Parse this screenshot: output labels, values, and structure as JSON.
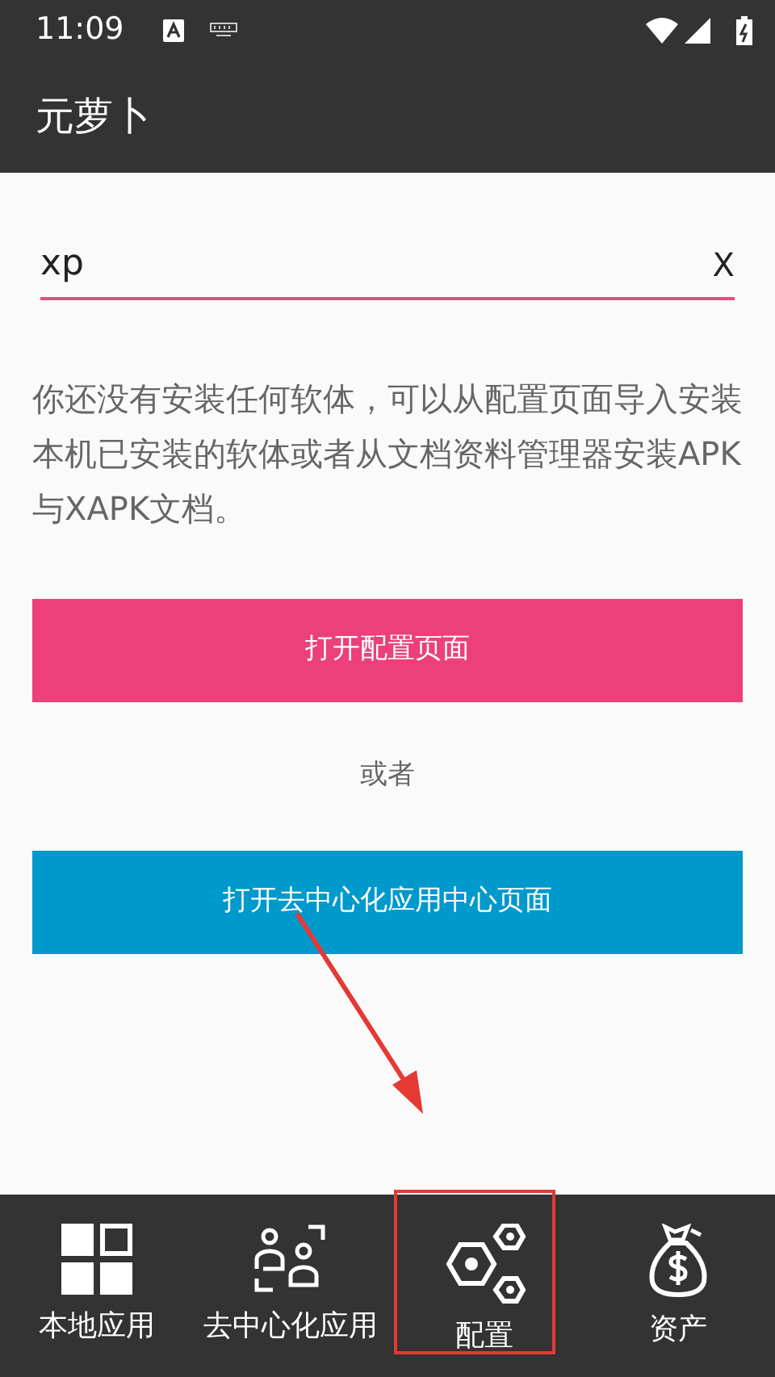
{
  "status_bar": {
    "time": "11:09"
  },
  "app_bar": {
    "title": "元萝卜"
  },
  "search": {
    "value": "xp",
    "clear": "X"
  },
  "message": "你还没有安装任何软体，可以从配置页面导入安装本机已安装的软体或者从文档资料管理器安装APK与XAPK文档。",
  "buttons": [
    {
      "label": "打开配置页面",
      "kind": "primary"
    },
    {
      "label": "打开去中心化应用中心页面",
      "kind": "secondary"
    }
  ],
  "separator": "或者",
  "bottom_nav": [
    {
      "label": "本地应用",
      "kind": "grid"
    },
    {
      "label": "去中心化应用",
      "kind": "people"
    },
    {
      "label": "配置",
      "kind": "config"
    },
    {
      "label": "资产",
      "kind": "money"
    }
  ]
}
